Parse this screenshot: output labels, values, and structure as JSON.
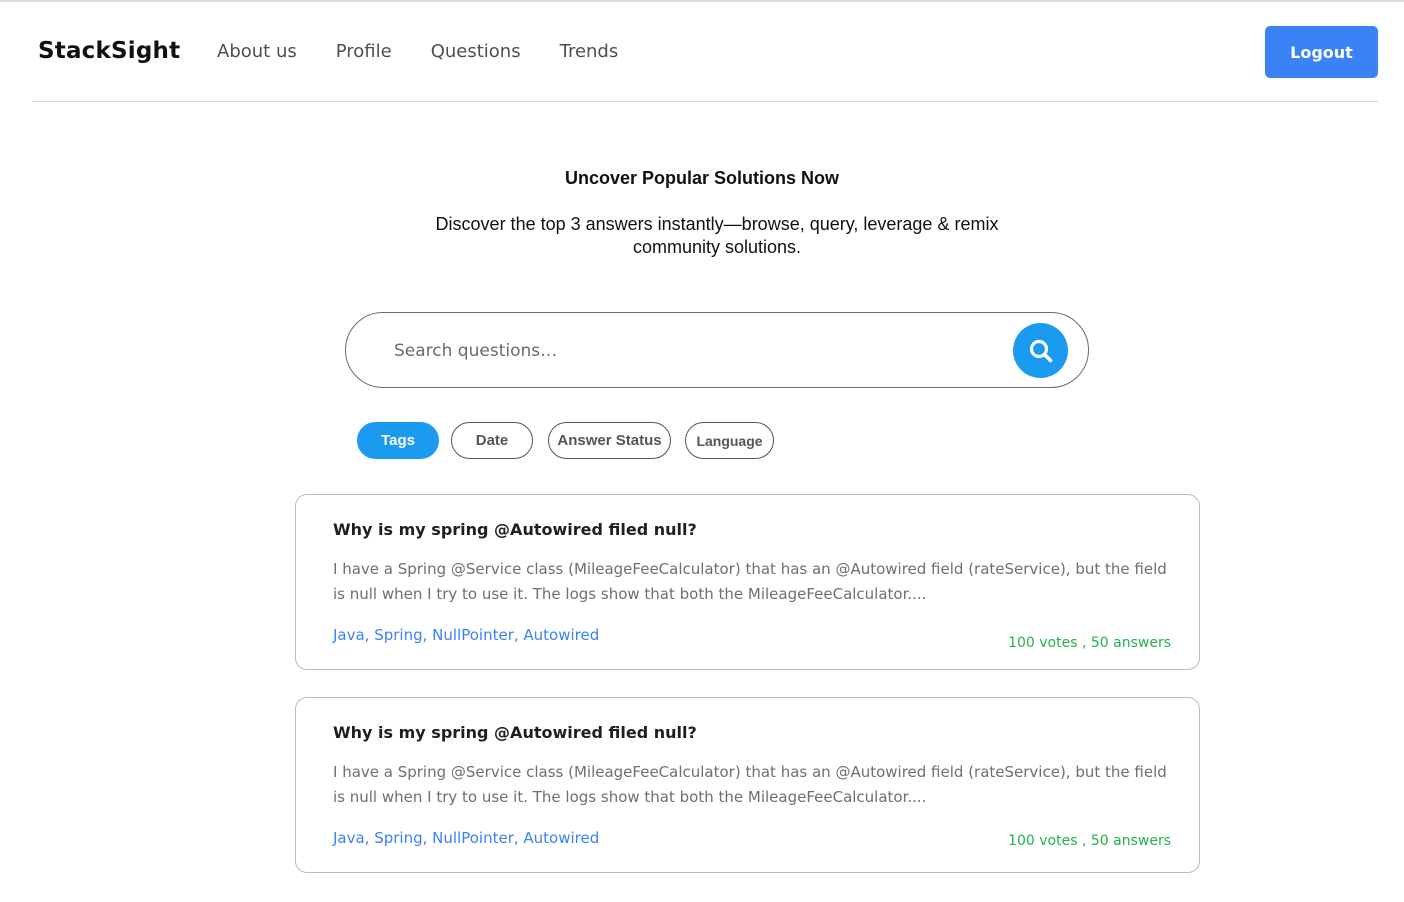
{
  "header": {
    "brand": "StackSight",
    "nav": [
      "About us",
      "Profile",
      "Questions",
      "Trends"
    ],
    "logout_label": "Logout"
  },
  "hero": {
    "title": "Uncover Popular Solutions Now",
    "subtitle": "Discover the top 3 answers instantly—browse, query, leverage & remix community solutions."
  },
  "search": {
    "placeholder": "Search questions…",
    "button_icon": "search-icon"
  },
  "filters": [
    {
      "label": "Tags",
      "active": true
    },
    {
      "label": "Date",
      "active": false
    },
    {
      "label": "Answer Status",
      "active": false
    },
    {
      "label": "Language",
      "active": false
    }
  ],
  "questions": [
    {
      "title": "Why is my spring @Autowired filed null?",
      "body": "I have a Spring @Service class (MileageFeeCalculator) that has an @Autowired field (rateService), but the field is null when I try to use it. The logs show that both the MileageFeeCalculator....",
      "tags": "Java, Spring, NullPointer, Autowired",
      "stats": "100 votes , 50 answers"
    },
    {
      "title": "Why is my spring @Autowired filed null?",
      "body": "I have a Spring @Service class (MileageFeeCalculator) that has an @Autowired field (rateService), but the field is null when I try to use it. The logs show that both the MileageFeeCalculator....",
      "tags": "Java, Spring, NullPointer, Autowired",
      "stats": "100 votes , 50 answers"
    }
  ],
  "colors": {
    "accent": "#1a9bf0",
    "logout": "#3b82f6",
    "tags": "#3b82f6",
    "stats": "#22b14c"
  }
}
